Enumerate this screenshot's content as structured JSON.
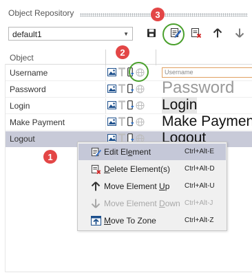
{
  "panel": {
    "title": "Object Repository"
  },
  "repository_select": {
    "value": "default1"
  },
  "toolbar": {
    "save_icon": "save-icon",
    "edit_icon": "edit-element-icon",
    "delete_icon": "delete-element-icon",
    "up_icon": "arrow-up-icon",
    "down_icon": "arrow-down-icon"
  },
  "table": {
    "header_object": "Object",
    "rows": [
      {
        "name": "Username",
        "preview": "",
        "placeholder": "Username"
      },
      {
        "name": "Password",
        "preview": "Password"
      },
      {
        "name": "Login",
        "preview": "Login"
      },
      {
        "name": "Make Payment",
        "preview": "Make Paymen"
      },
      {
        "name": "Logout",
        "preview": "Logout"
      }
    ]
  },
  "context_menu": {
    "items": [
      {
        "pre": "Edit El",
        "u": "e",
        "post": "ment",
        "shortcut": "Ctrl+Alt-E",
        "icon": "edit-element-icon",
        "disabled": false
      },
      {
        "pre": "",
        "u": "D",
        "post": "elete Element(s)",
        "shortcut": "Ctrl+Alt-D",
        "icon": "delete-element-icon",
        "disabled": false
      },
      {
        "pre": "Move Element ",
        "u": "U",
        "post": "p",
        "shortcut": "Ctrl+Alt-U",
        "icon": "arrow-up-icon",
        "disabled": false
      },
      {
        "pre": "Move Element ",
        "u": "D",
        "post": "own",
        "shortcut": "Ctrl+Alt-J",
        "icon": "arrow-down-icon",
        "disabled": true
      },
      {
        "pre": "",
        "u": "M",
        "post": "ove To Zone",
        "shortcut": "Ctrl+Alt-Z",
        "icon": "move-to-zone-icon",
        "disabled": false
      }
    ]
  },
  "callouts": {
    "one": "1",
    "two": "2",
    "three": "3"
  },
  "colors": {
    "callout": "#e34646",
    "ring": "#4aa02c",
    "selected_row": "#c8cad8",
    "menu_hover": "#c5c8d8"
  }
}
